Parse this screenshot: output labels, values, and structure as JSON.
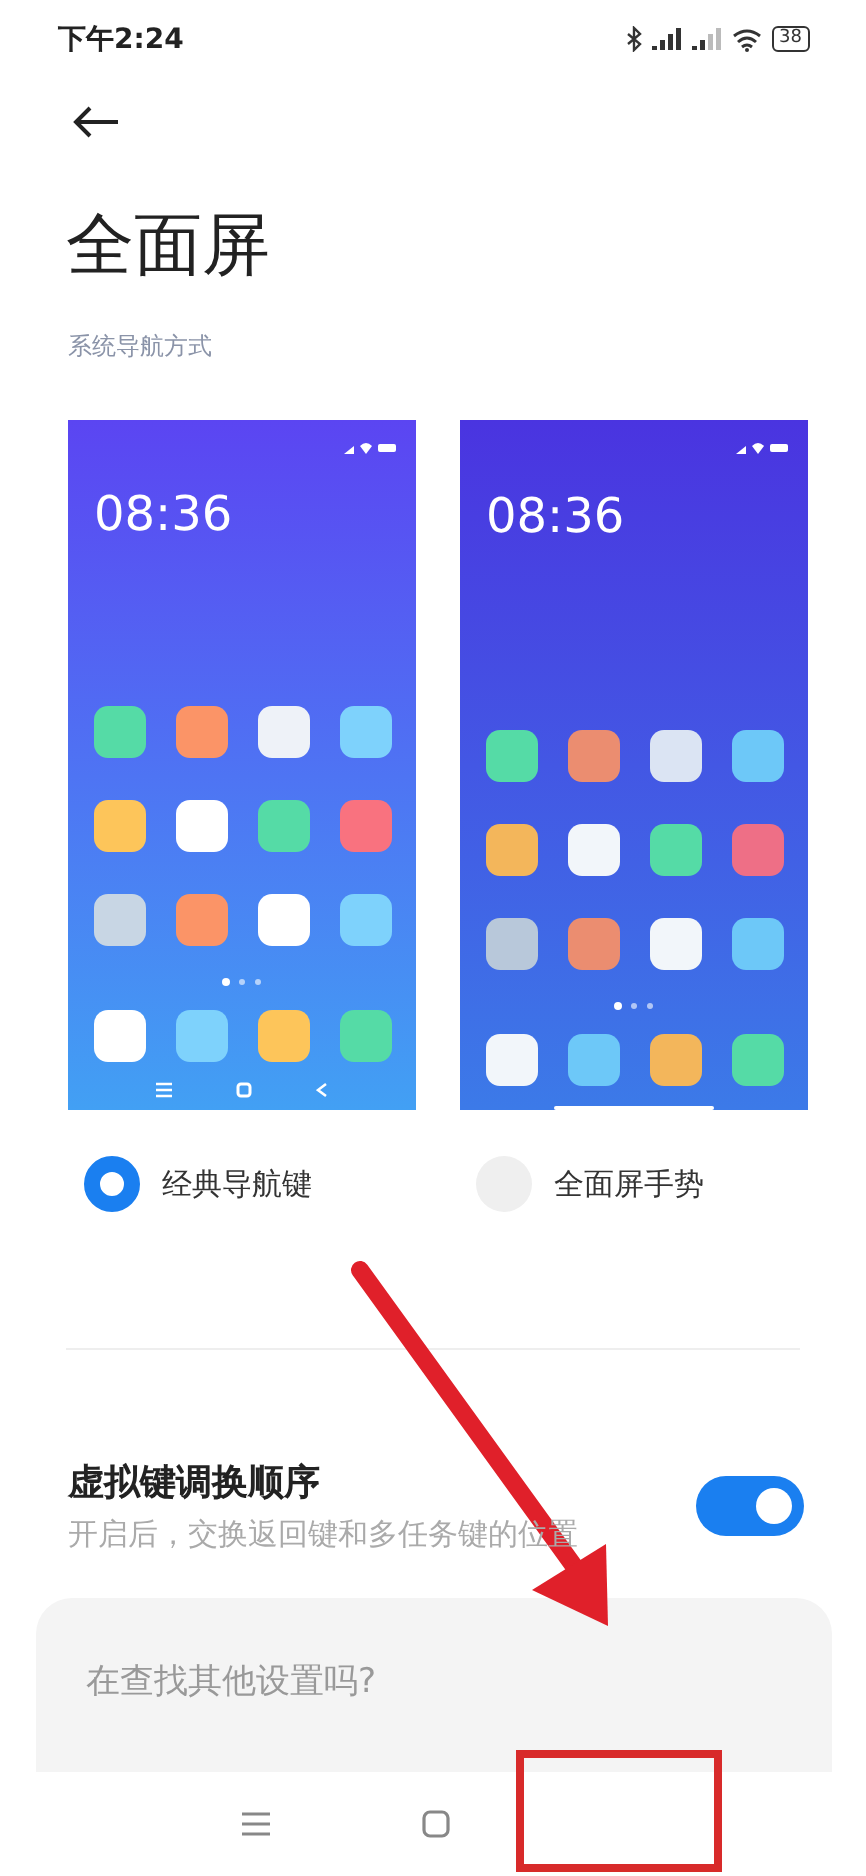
{
  "status_bar": {
    "time": "下午2:24",
    "battery": "38"
  },
  "title": "全面屏",
  "section_label": "系统导航方式",
  "nav_options": [
    {
      "kind": "buttons",
      "preview_time": "08:36",
      "label": "经典导航键",
      "selected": true
    },
    {
      "kind": "gesture",
      "preview_time": "08:36",
      "label": "全面屏手势",
      "selected": false
    }
  ],
  "swap_setting": {
    "title": "虚拟键调换顺序",
    "subtitle": "开启后，交换返回键和多任务键的位置",
    "on": true
  },
  "suggest_card": {
    "title": "在查找其他设置吗?"
  },
  "annotation": {
    "arrow": true,
    "highlight": true
  }
}
